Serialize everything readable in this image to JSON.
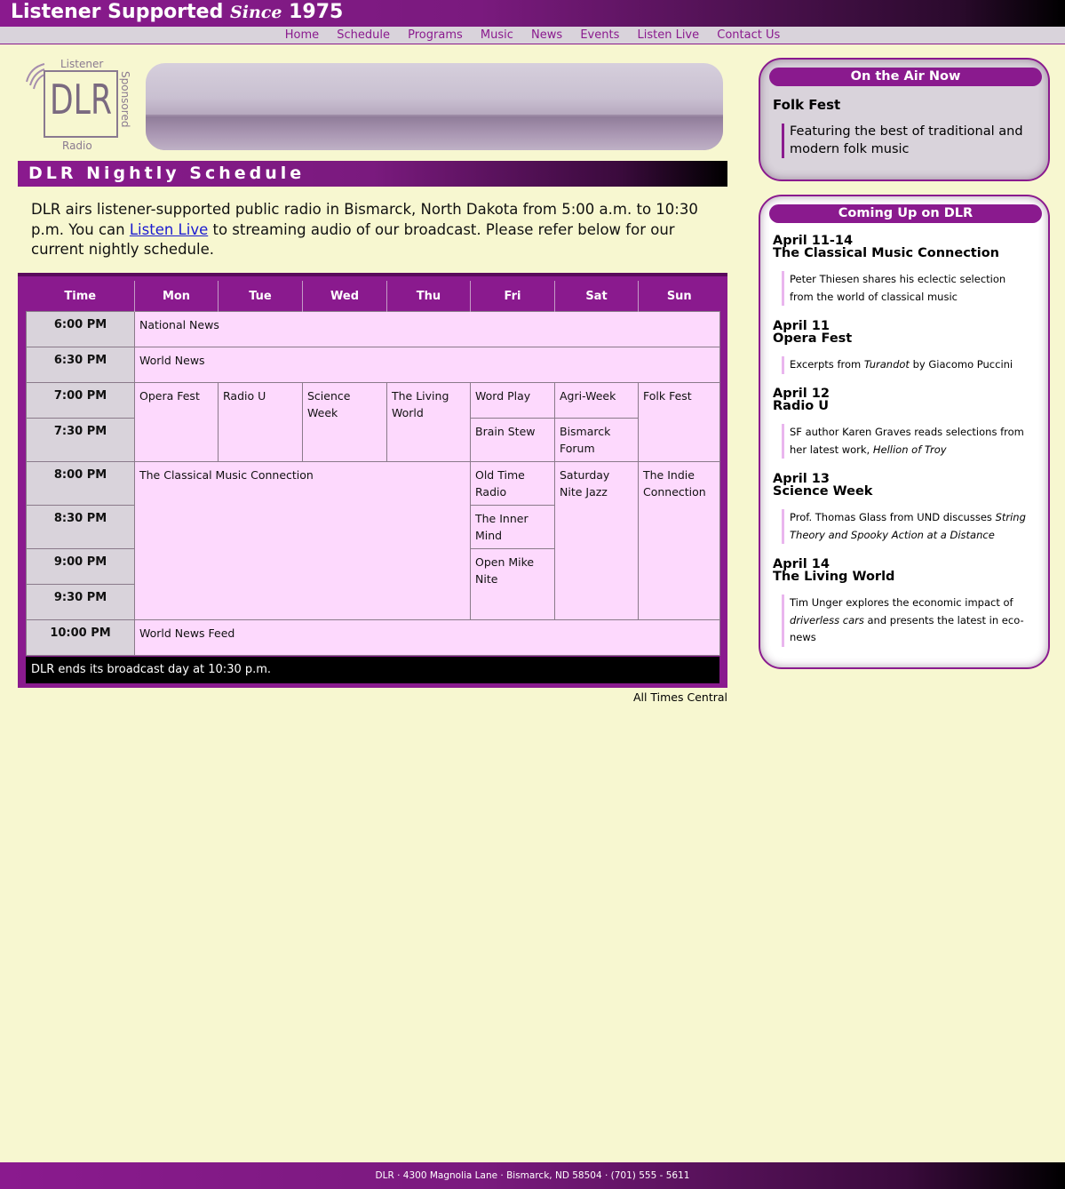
{
  "header": {
    "tagline_1": "Listener Supported",
    "tagline_since": "Since",
    "tagline_year": "1975"
  },
  "nav": [
    "Home",
    "Schedule",
    "Programs",
    "Music",
    "News",
    "Events",
    "Listen Live",
    "Contact Us"
  ],
  "logo": {
    "top": "Listener",
    "letters": "DLR",
    "side": "Sponsored",
    "bottom": "Radio"
  },
  "page_title": "DLR Nightly Schedule",
  "intro": {
    "part1": "DLR airs listener-supported public radio in Bismarck, North Dakota from 5:00 a.m. to 10:30 p.m. You can ",
    "link": "Listen Live",
    "part2": " to streaming audio of our broadcast. Please refer below for our current nightly schedule."
  },
  "schedule": {
    "headers": [
      "Time",
      "Mon",
      "Tue",
      "Wed",
      "Thu",
      "Fri",
      "Sat",
      "Sun"
    ],
    "times": [
      "6:00 PM",
      "6:30 PM",
      "7:00 PM",
      "7:30 PM",
      "8:00 PM",
      "8:30 PM",
      "9:00 PM",
      "9:30 PM",
      "10:00 PM"
    ],
    "national_news": "National News",
    "world_news": "World News",
    "opera_fest": "Opera Fest",
    "radio_u": "Radio U",
    "science_week": "Science Week",
    "living_world": "The Living World",
    "word_play": "Word Play",
    "agri_week": "Agri-Week",
    "folk_fest": "Folk Fest",
    "brain_stew": "Brain Stew",
    "bismarck_forum": "Bismarck Forum",
    "classical": "The Classical Music Connection",
    "old_time_radio": "Old Time Radio",
    "saturday_nite_jazz": "Saturday Nite Jazz",
    "indie_connection": "The Indie Connection",
    "inner_mind": "The Inner Mind",
    "open_mike": "Open Mike Nite",
    "world_news_feed": "World News Feed",
    "end_note": "DLR ends its broadcast day at 10:30 p.m."
  },
  "times_note": "All Times Central",
  "on_air": {
    "heading": "On the Air Now",
    "show": "Folk Fest",
    "description": "Featuring the best of traditional and modern folk music"
  },
  "coming_up": {
    "heading": "Coming Up on DLR",
    "events": [
      {
        "date": "April 11-14",
        "name": "The Classical Music Connection",
        "desc": "Peter Thiesen shares his eclectic selection from the world of classical music"
      },
      {
        "date": "April 11",
        "name": "Opera Fest",
        "desc_a": "Excerpts from ",
        "desc_i": "Turandot",
        "desc_b": " by Giacomo Puccini"
      },
      {
        "date": "April 12",
        "name": "Radio U",
        "desc_a": "SF author Karen Graves reads selections from her latest work, ",
        "desc_i": "Hellion of Troy",
        "desc_b": ""
      },
      {
        "date": "April 13",
        "name": "Science Week",
        "desc_a": "Prof. Thomas Glass from UND discusses ",
        "desc_i": "String Theory and Spooky Action at a Distance",
        "desc_b": ""
      },
      {
        "date": "April 14",
        "name": "The Living World",
        "desc_a": "Tim Unger explores the economic impact of ",
        "desc_i": "driverless cars",
        "desc_b": " and presents the latest in eco-news"
      }
    ]
  },
  "footer": "DLR · 4300 Magnolia Lane · Bismarck, ND 58504 · (701) 555 - 5611",
  "colors": {
    "accent": "#8a1a8e",
    "background": "#f7f7d0",
    "cell": "#fdd9fd",
    "time_cell": "#d9d3db"
  }
}
